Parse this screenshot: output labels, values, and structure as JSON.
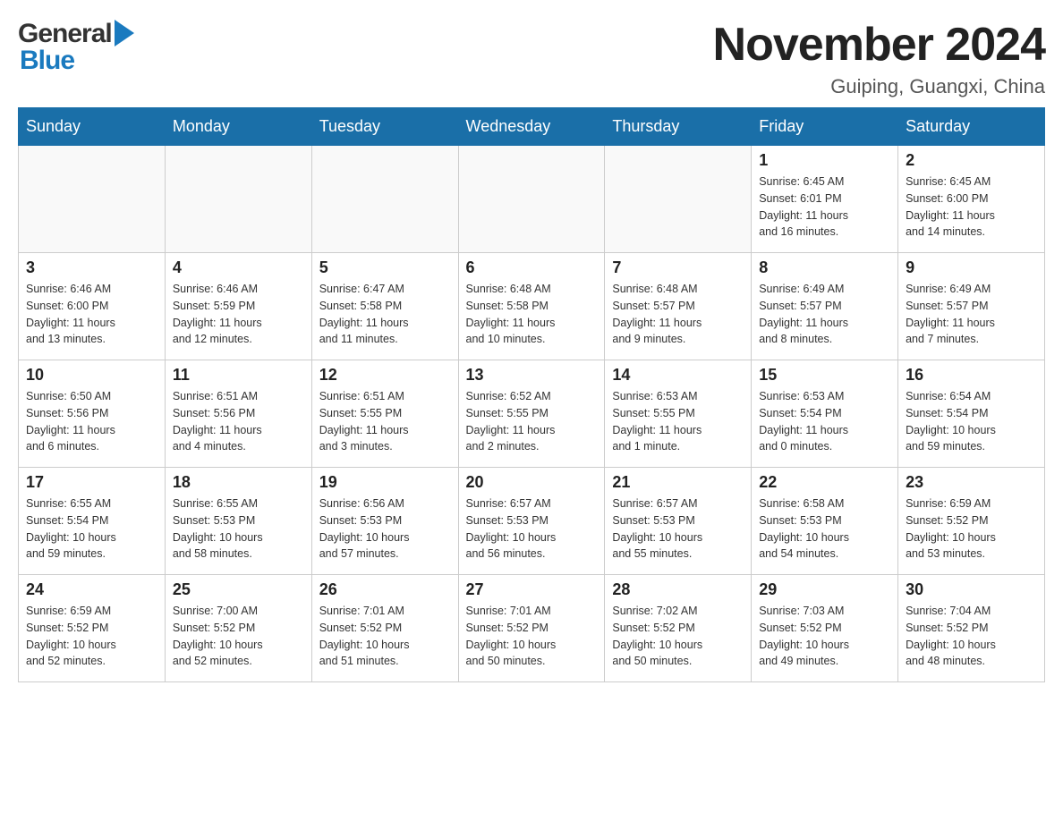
{
  "header": {
    "title": "November 2024",
    "subtitle": "Guiping, Guangxi, China",
    "logo_general": "General",
    "logo_blue": "Blue"
  },
  "weekdays": [
    "Sunday",
    "Monday",
    "Tuesday",
    "Wednesday",
    "Thursday",
    "Friday",
    "Saturday"
  ],
  "weeks": [
    [
      {
        "day": "",
        "info": ""
      },
      {
        "day": "",
        "info": ""
      },
      {
        "day": "",
        "info": ""
      },
      {
        "day": "",
        "info": ""
      },
      {
        "day": "",
        "info": ""
      },
      {
        "day": "1",
        "info": "Sunrise: 6:45 AM\nSunset: 6:01 PM\nDaylight: 11 hours\nand 16 minutes."
      },
      {
        "day": "2",
        "info": "Sunrise: 6:45 AM\nSunset: 6:00 PM\nDaylight: 11 hours\nand 14 minutes."
      }
    ],
    [
      {
        "day": "3",
        "info": "Sunrise: 6:46 AM\nSunset: 6:00 PM\nDaylight: 11 hours\nand 13 minutes."
      },
      {
        "day": "4",
        "info": "Sunrise: 6:46 AM\nSunset: 5:59 PM\nDaylight: 11 hours\nand 12 minutes."
      },
      {
        "day": "5",
        "info": "Sunrise: 6:47 AM\nSunset: 5:58 PM\nDaylight: 11 hours\nand 11 minutes."
      },
      {
        "day": "6",
        "info": "Sunrise: 6:48 AM\nSunset: 5:58 PM\nDaylight: 11 hours\nand 10 minutes."
      },
      {
        "day": "7",
        "info": "Sunrise: 6:48 AM\nSunset: 5:57 PM\nDaylight: 11 hours\nand 9 minutes."
      },
      {
        "day": "8",
        "info": "Sunrise: 6:49 AM\nSunset: 5:57 PM\nDaylight: 11 hours\nand 8 minutes."
      },
      {
        "day": "9",
        "info": "Sunrise: 6:49 AM\nSunset: 5:57 PM\nDaylight: 11 hours\nand 7 minutes."
      }
    ],
    [
      {
        "day": "10",
        "info": "Sunrise: 6:50 AM\nSunset: 5:56 PM\nDaylight: 11 hours\nand 6 minutes."
      },
      {
        "day": "11",
        "info": "Sunrise: 6:51 AM\nSunset: 5:56 PM\nDaylight: 11 hours\nand 4 minutes."
      },
      {
        "day": "12",
        "info": "Sunrise: 6:51 AM\nSunset: 5:55 PM\nDaylight: 11 hours\nand 3 minutes."
      },
      {
        "day": "13",
        "info": "Sunrise: 6:52 AM\nSunset: 5:55 PM\nDaylight: 11 hours\nand 2 minutes."
      },
      {
        "day": "14",
        "info": "Sunrise: 6:53 AM\nSunset: 5:55 PM\nDaylight: 11 hours\nand 1 minute."
      },
      {
        "day": "15",
        "info": "Sunrise: 6:53 AM\nSunset: 5:54 PM\nDaylight: 11 hours\nand 0 minutes."
      },
      {
        "day": "16",
        "info": "Sunrise: 6:54 AM\nSunset: 5:54 PM\nDaylight: 10 hours\nand 59 minutes."
      }
    ],
    [
      {
        "day": "17",
        "info": "Sunrise: 6:55 AM\nSunset: 5:54 PM\nDaylight: 10 hours\nand 59 minutes."
      },
      {
        "day": "18",
        "info": "Sunrise: 6:55 AM\nSunset: 5:53 PM\nDaylight: 10 hours\nand 58 minutes."
      },
      {
        "day": "19",
        "info": "Sunrise: 6:56 AM\nSunset: 5:53 PM\nDaylight: 10 hours\nand 57 minutes."
      },
      {
        "day": "20",
        "info": "Sunrise: 6:57 AM\nSunset: 5:53 PM\nDaylight: 10 hours\nand 56 minutes."
      },
      {
        "day": "21",
        "info": "Sunrise: 6:57 AM\nSunset: 5:53 PM\nDaylight: 10 hours\nand 55 minutes."
      },
      {
        "day": "22",
        "info": "Sunrise: 6:58 AM\nSunset: 5:53 PM\nDaylight: 10 hours\nand 54 minutes."
      },
      {
        "day": "23",
        "info": "Sunrise: 6:59 AM\nSunset: 5:52 PM\nDaylight: 10 hours\nand 53 minutes."
      }
    ],
    [
      {
        "day": "24",
        "info": "Sunrise: 6:59 AM\nSunset: 5:52 PM\nDaylight: 10 hours\nand 52 minutes."
      },
      {
        "day": "25",
        "info": "Sunrise: 7:00 AM\nSunset: 5:52 PM\nDaylight: 10 hours\nand 52 minutes."
      },
      {
        "day": "26",
        "info": "Sunrise: 7:01 AM\nSunset: 5:52 PM\nDaylight: 10 hours\nand 51 minutes."
      },
      {
        "day": "27",
        "info": "Sunrise: 7:01 AM\nSunset: 5:52 PM\nDaylight: 10 hours\nand 50 minutes."
      },
      {
        "day": "28",
        "info": "Sunrise: 7:02 AM\nSunset: 5:52 PM\nDaylight: 10 hours\nand 50 minutes."
      },
      {
        "day": "29",
        "info": "Sunrise: 7:03 AM\nSunset: 5:52 PM\nDaylight: 10 hours\nand 49 minutes."
      },
      {
        "day": "30",
        "info": "Sunrise: 7:04 AM\nSunset: 5:52 PM\nDaylight: 10 hours\nand 48 minutes."
      }
    ]
  ]
}
